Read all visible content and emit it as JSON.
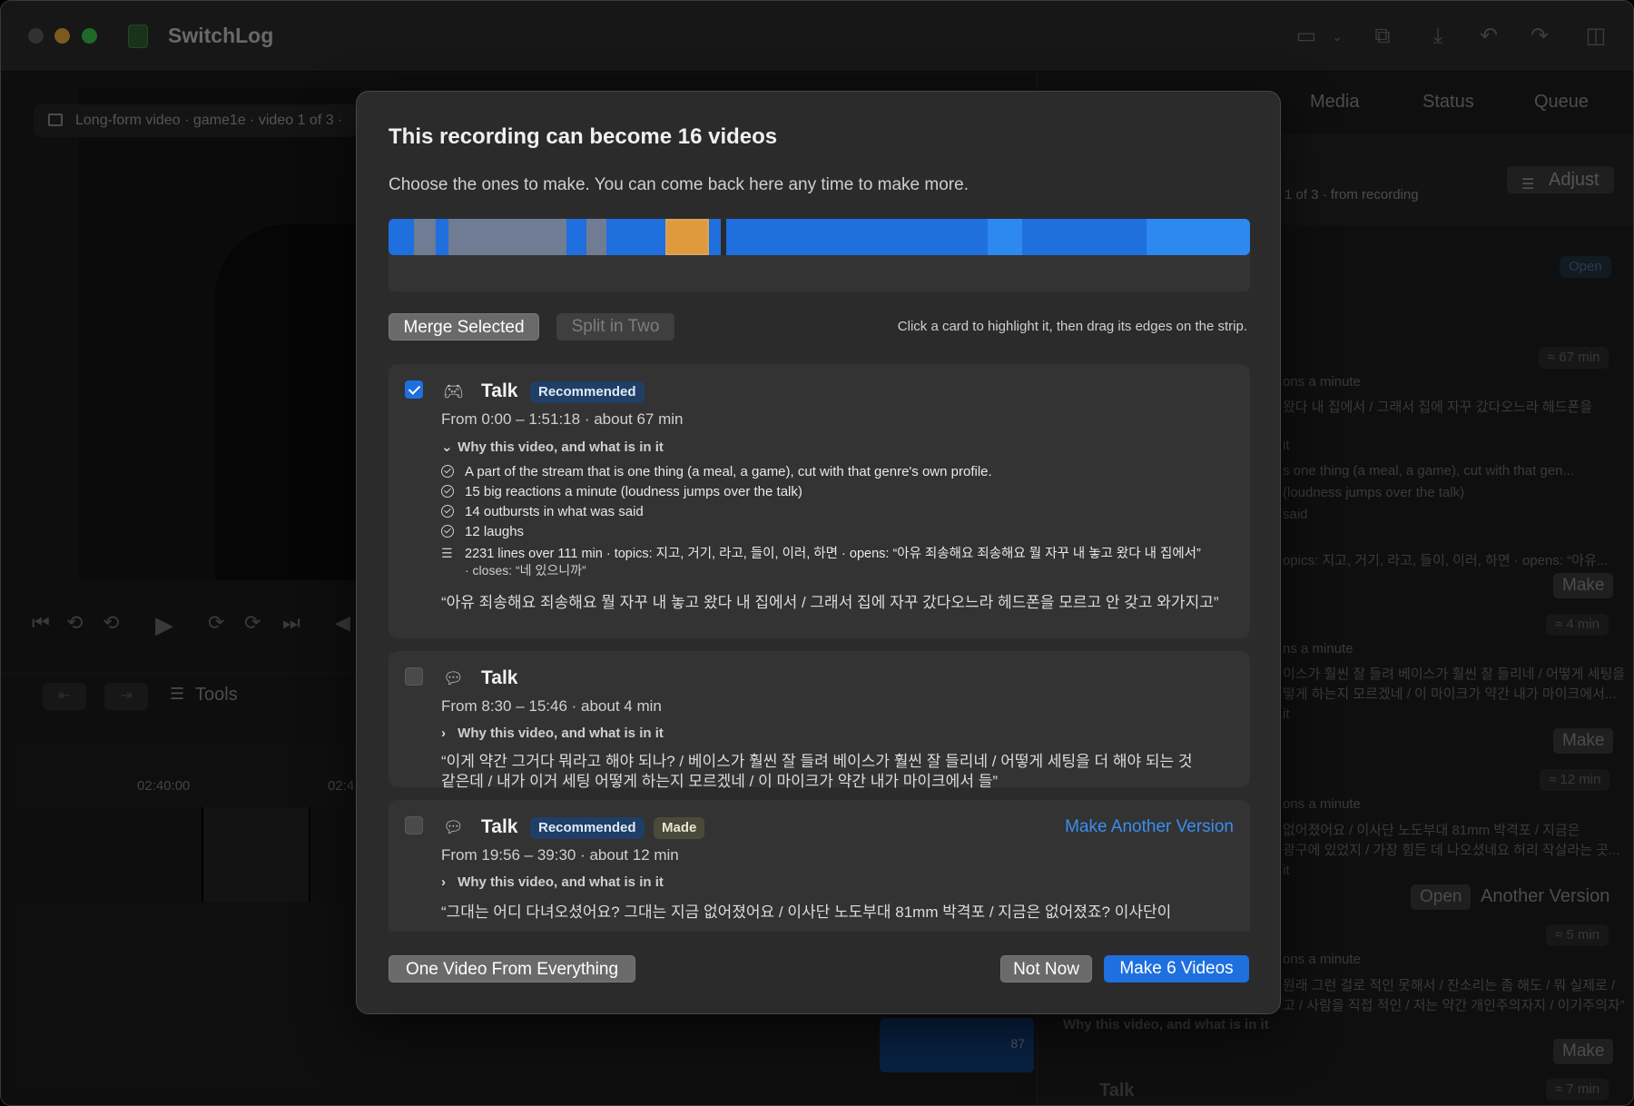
{
  "app": {
    "title": "SwitchLog"
  },
  "colors": {
    "accent": "#1f6fdf",
    "strip_highlight": "#e09a3b"
  },
  "backdrop": {
    "breadcrumb": "Long-form video · game1e · video 1 of 3 ·",
    "tools_label": "Tools",
    "timeline": {
      "time_1": "02:40:00",
      "time_2": "02:4",
      "clip_count": "87"
    },
    "right_tabs": [
      "Media",
      "Status",
      "Queue"
    ],
    "adjust_label": "Adjust",
    "subtitle": "1 of 3 · from recording",
    "pills": [
      "Open",
      "≈ 67 min",
      "≈ 4 min",
      "≈ 12 min",
      "≈ 5 min",
      "≈ 7 min"
    ],
    "make_label": "Make",
    "open_label": "Open",
    "another_version_label": "Another Version",
    "lines": [
      "ons a minute",
      "왔다 내 집에서 / 그래서 집에 자꾸 갔다오느라 헤드폰을",
      "it",
      "s one thing (a meal, a game), cut with that gen...",
      "(loudness jumps over the talk)",
      "said",
      "opics: 지고, 거기, 라고, 들이, 이러, 하면 · opens: “아유...",
      "ns a minute",
      "이스가 훨씬 잘 들려 베이스가 훨씬 잘 들리네 / 어떻게 세팅을",
      "떻게 하는지 모르겠네 / 이 마이크가 약간 내가 마이크에서...",
      "it",
      "ons a minute",
      "없어졌어요 / 이사단 노도부대 81mm 박격포 / 지금은",
      "광구에 있었지 / 가장 힘든 데 나오셨네요 허리 작살라는 곳...",
      "it",
      "ons a minute",
      "원래 그런 걸로 적인 못해서 / 잔소리는 좀 해도 / 뭐 실제로 /",
      "고 / 사람을 직접 적인 / 저는 약간 개인주의자지 / 이기주의자”",
      "Why this video, and what is in it",
      "Talk"
    ]
  },
  "sheet": {
    "title": "This recording can become 16 videos",
    "subtitle": "Choose the ones to make. You can come back here any time to make more.",
    "merge_label": "Merge Selected",
    "split_label": "Split in Two",
    "hint": "Click a card to highlight it, then drag its edges on the strip.",
    "cards": [
      {
        "checked": true,
        "icon": "gamepad-icon",
        "title": "Talk",
        "badges": [
          "Recommended"
        ],
        "range": "From 0:00 – 1:51:18 · about 67 min",
        "why": "Why this video, and what is in it",
        "reasons": [
          "A part of the stream that is one thing (a meal, a game), cut with that genre's own profile.",
          "15 big reactions a minute (loudness jumps over the talk)",
          "14 outbursts in what was said",
          "12 laughs"
        ],
        "transcript_line1": "2231 lines over 111 min · topics: 지고, 거기, 라고, 들이, 이러, 하면 · opens: “아유 죄송해요 죄송해요 뭘 자꾸 내 놓고 왔다 내 집에서”",
        "transcript_line2": "· closes: “네 있으니까”",
        "quote": "“아유 죄송해요 죄송해요 뭘 자꾸 내 놓고 왔다 내 집에서 / 그래서 집에 자꾸 갔다오느라 헤드폰을 모르고 안 갖고 와가지고”"
      },
      {
        "checked": false,
        "icon": "chat-bubbles-icon",
        "title": "Talk",
        "badges": [],
        "range": "From 8:30 – 15:46 · about 4 min",
        "why": "Why this video, and what is in it",
        "quote_line1": "“이게 약간 그거다 뭐라고 해야 되나? / 베이스가 훨씬 잘 들려 베이스가 훨씬 잘 들리네 / 어떻게 세팅을 더 해야 되는 것",
        "quote_line2": "같은데 / 내가 이거 세팅 어떻게 하는지 모르겠네 / 이 마이크가 약간 내가 마이크에서 들”"
      },
      {
        "checked": false,
        "icon": "chat-bubbles-icon",
        "title": "Talk",
        "badges": [
          "Recommended",
          "Made"
        ],
        "make_another": "Make Another Version",
        "range": "From 19:56 – 39:30 · about 12 min",
        "why": "Why this video, and what is in it",
        "quote": "“그대는 어디 다녀오셨어요? 그대는 지금 없어졌어요 / 이사단 노도부대 81mm 박격포 / 지금은 없어졌죠? 이사단이"
      }
    ],
    "one_video_label": "One Video From Everything",
    "not_now_label": "Not Now",
    "make_videos_label": "Make 6 Videos"
  }
}
